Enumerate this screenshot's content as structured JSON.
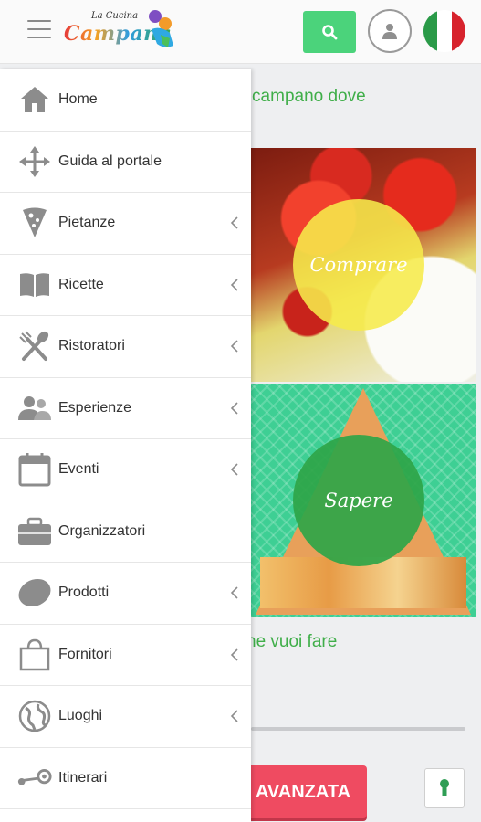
{
  "header": {
    "logo_small": "La Cucina",
    "logo_big": "Campana",
    "search_icon": "search-icon",
    "user_icon": "user-icon",
    "flag_colors": [
      "#2a9a48",
      "#ffffff",
      "#d7232d"
    ]
  },
  "page": {
    "intro_text": "po tipico campano dove\nsa vuoi...",
    "tiles": [
      {
        "label": "Comprare"
      },
      {
        "label": "Sapere"
      }
    ],
    "what_text": "he vuoi fare",
    "advanced_button": "AVANZATA"
  },
  "menu": {
    "items": [
      {
        "label": "Home",
        "icon": "home-icon",
        "has_submenu": false
      },
      {
        "label": "Guida al portale",
        "icon": "move-arrows-icon",
        "has_submenu": false
      },
      {
        "label": "Pietanze",
        "icon": "pizza-slice-icon",
        "has_submenu": true
      },
      {
        "label": "Ricette",
        "icon": "open-book-icon",
        "has_submenu": true
      },
      {
        "label": "Ristoratori",
        "icon": "fork-spoon-icon",
        "has_submenu": true
      },
      {
        "label": "Esperienze",
        "icon": "people-icon",
        "has_submenu": true
      },
      {
        "label": "Eventi",
        "icon": "calendar-icon",
        "has_submenu": true
      },
      {
        "label": "Organizzatori",
        "icon": "briefcase-icon",
        "has_submenu": false
      },
      {
        "label": "Prodotti",
        "icon": "lemon-icon",
        "has_submenu": true
      },
      {
        "label": "Fornitori",
        "icon": "shopping-bag-icon",
        "has_submenu": true
      },
      {
        "label": "Luoghi",
        "icon": "globe-icon",
        "has_submenu": true
      },
      {
        "label": "Itinerari",
        "icon": "steam-route-icon",
        "has_submenu": false
      }
    ]
  },
  "colors": {
    "accent_green": "#4bd37b",
    "text_green": "#3fae49",
    "advanced_red": "#ef4b61",
    "icon_grey": "#8c8c8c"
  }
}
